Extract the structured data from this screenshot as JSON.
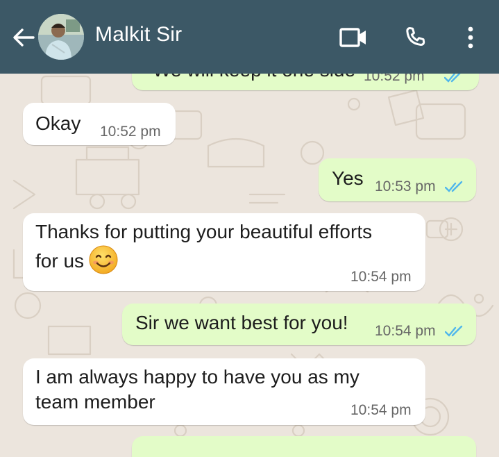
{
  "header": {
    "contact_name": "Malkit Sir",
    "icons": [
      "back-arrow-icon",
      "avatar",
      "video-call-icon",
      "voice-call-icon",
      "more-options-icon"
    ],
    "background_color": "#3c5866"
  },
  "colors": {
    "chat_background": "#ece5dd",
    "incoming_bubble": "#ffffff",
    "outgoing_bubble": "#e3fcc8",
    "read_ticks": "#4fb6ec"
  },
  "messages": [
    {
      "direction": "outgoing",
      "text": "We will keep it one side",
      "time": "10:52 pm",
      "status": "read"
    },
    {
      "direction": "incoming",
      "text": "Okay",
      "time": "10:52 pm"
    },
    {
      "direction": "outgoing",
      "text": "Yes",
      "time": "10:53 pm",
      "status": "read"
    },
    {
      "direction": "incoming",
      "lines": [
        "Thanks for putting your beautiful efforts",
        "for us"
      ],
      "emoji": "smiling-face-emoji",
      "time": "10:54 pm"
    },
    {
      "direction": "outgoing",
      "text": "Sir we want best for you!",
      "time": "10:54 pm",
      "status": "read"
    },
    {
      "direction": "incoming",
      "lines": [
        "I am always happy to have you as my",
        "team member"
      ],
      "time": "10:54 pm"
    }
  ]
}
